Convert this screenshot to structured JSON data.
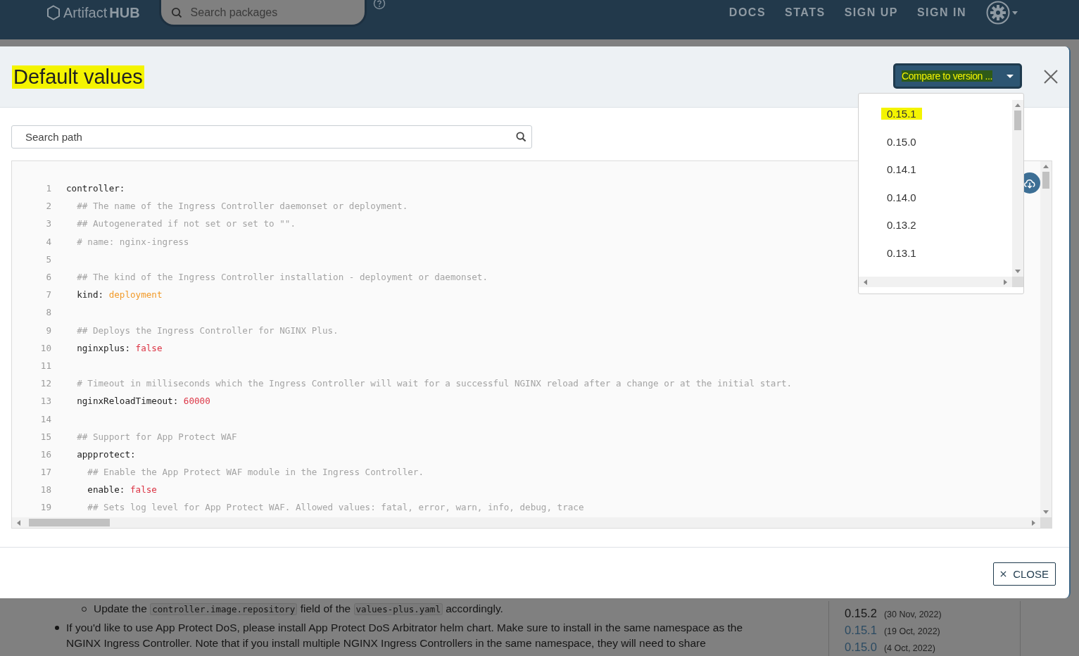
{
  "navbar": {
    "logo": {
      "light": "Artifact",
      "bold": "HUB"
    },
    "search": {
      "placeholder": "Search packages"
    },
    "links": [
      "DOCS",
      "STATS",
      "SIGN UP",
      "SIGN IN"
    ]
  },
  "page": {
    "list": [
      {
        "kind": "sub",
        "parts": [
          {
            "kind": "text",
            "text": "Update the "
          },
          {
            "kind": "code",
            "text": "controller.image.repository"
          },
          {
            "kind": "text",
            "text": " field of the "
          },
          {
            "kind": "code",
            "text": "values-plus.yaml"
          },
          {
            "kind": "text",
            "text": " accordingly."
          }
        ]
      },
      {
        "kind": "main",
        "parts": [
          {
            "kind": "text",
            "text": "If you'd like to use App Protect DoS, please install App Protect DoS Arbitrator helm chart. Make sure to install in the same namespace as the NGINX Ingress Controller. Note that if you install multiple NGINX Ingress Controllers in the same namespace, they will need to share"
          }
        ]
      }
    ],
    "versions": [
      {
        "version": "0.15.2",
        "date": "(30 Nov, 2022)",
        "current": true
      },
      {
        "version": "0.15.1",
        "date": "(19 Oct, 2022)",
        "current": false
      },
      {
        "version": "0.15.0",
        "date": "(4 Oct, 2022)",
        "current": false
      }
    ]
  },
  "modal": {
    "title": "Default values",
    "title_highlighted": true,
    "compare": {
      "label": "Compare to version ...",
      "highlighted": true,
      "expanded": true
    },
    "version_options": [
      {
        "label": "0.15.1",
        "selected": true
      },
      {
        "label": "0.15.0",
        "selected": false
      },
      {
        "label": "0.14.1",
        "selected": false
      },
      {
        "label": "0.14.0",
        "selected": false
      },
      {
        "label": "0.13.2",
        "selected": false
      },
      {
        "label": "0.13.1",
        "selected": false
      }
    ],
    "search": {
      "placeholder": "Search path"
    },
    "code": [
      {
        "number": "1",
        "tokens": [
          {
            "kind": "key",
            "text": "controller:"
          }
        ]
      },
      {
        "number": "2",
        "tokens": [
          {
            "kind": "comment",
            "text": "  ## The name of the Ingress Controller daemonset or deployment."
          }
        ]
      },
      {
        "number": "3",
        "tokens": [
          {
            "kind": "comment",
            "text": "  ## Autogenerated if not set or set to \"\"."
          }
        ]
      },
      {
        "number": "4",
        "tokens": [
          {
            "kind": "comment",
            "text": "  # name: nginx-ingress"
          }
        ]
      },
      {
        "number": "5"
      },
      {
        "number": "6",
        "tokens": [
          {
            "kind": "comment",
            "text": "  ## The kind of the Ingress Controller installation - deployment or daemonset."
          }
        ]
      },
      {
        "number": "7",
        "tokens": [
          {
            "kind": "key",
            "text": "  kind: "
          },
          {
            "kind": "string",
            "text": "deployment"
          }
        ]
      },
      {
        "number": "8"
      },
      {
        "number": "9",
        "tokens": [
          {
            "kind": "comment",
            "text": "  ## Deploys the Ingress Controller for NGINX Plus."
          }
        ]
      },
      {
        "number": "10",
        "tokens": [
          {
            "kind": "key",
            "text": "  nginxplus: "
          },
          {
            "kind": "literal",
            "text": "false"
          }
        ]
      },
      {
        "number": "11"
      },
      {
        "number": "12",
        "tokens": [
          {
            "kind": "comment",
            "text": "  # Timeout in milliseconds which the Ingress Controller will wait for a successful NGINX reload after a change or at the initial start."
          }
        ]
      },
      {
        "number": "13",
        "tokens": [
          {
            "kind": "key",
            "text": "  nginxReloadTimeout: "
          },
          {
            "kind": "literal",
            "text": "60000"
          }
        ]
      },
      {
        "number": "14"
      },
      {
        "number": "15",
        "tokens": [
          {
            "kind": "comment",
            "text": "  ## Support for App Protect WAF"
          }
        ]
      },
      {
        "number": "16",
        "tokens": [
          {
            "kind": "key",
            "text": "  appprotect:"
          }
        ]
      },
      {
        "number": "17",
        "tokens": [
          {
            "kind": "comment",
            "text": "    ## Enable the App Protect WAF module in the Ingress Controller."
          }
        ]
      },
      {
        "number": "18",
        "tokens": [
          {
            "kind": "key",
            "text": "    enable: "
          },
          {
            "kind": "literal",
            "text": "false"
          }
        ]
      },
      {
        "number": "19",
        "tokens": [
          {
            "kind": "comment",
            "text": "    ## Sets log level for App Protect WAF. Allowed values: fatal, error, warn, info, debug, trace"
          }
        ]
      }
    ],
    "close_label": "CLOSE"
  }
}
